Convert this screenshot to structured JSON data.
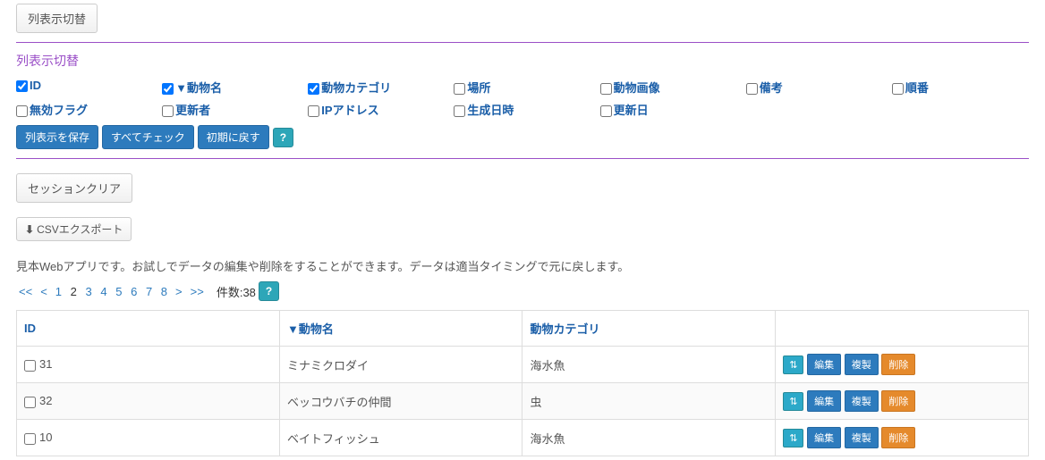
{
  "toggleButton": "列表示切替",
  "toggleTitle": "列表示切替",
  "columns": [
    {
      "label": "ID",
      "checked": true
    },
    {
      "label": "▼動物名",
      "checked": true
    },
    {
      "label": "動物カテゴリ",
      "checked": true
    },
    {
      "label": "場所",
      "checked": false
    },
    {
      "label": "動物画像",
      "checked": false
    },
    {
      "label": "備考",
      "checked": false
    },
    {
      "label": "順番",
      "checked": false
    },
    {
      "label": "無効フラグ",
      "checked": false
    },
    {
      "label": "更新者",
      "checked": false
    },
    {
      "label": "IPアドレス",
      "checked": false
    },
    {
      "label": "生成日時",
      "checked": false
    },
    {
      "label": "更新日",
      "checked": false
    }
  ],
  "saveCols": "列表示を保存",
  "checkAll": "すべてチェック",
  "resetCols": "初期に戻す",
  "help": "?",
  "sessionClear": "セッションクリア",
  "csvExport": "CSVエクスポート",
  "infoText": "見本Webアプリです。お試しでデータの編集や削除をすることができます。データは適当タイミングで元に戻します。",
  "pager": {
    "first": "<<",
    "prev": "<",
    "pages": [
      "1",
      "2",
      "3",
      "4",
      "5",
      "6",
      "7",
      "8"
    ],
    "current": "2",
    "next": ">",
    "last": ">>",
    "countLabel": "件数:",
    "countValue": "38"
  },
  "headers": {
    "id": "ID",
    "name": "▼動物名",
    "category": "動物カテゴリ",
    "actions": ""
  },
  "rows": [
    {
      "id": "31",
      "name": "ミナミクロダイ",
      "category": "海水魚"
    },
    {
      "id": "32",
      "name": "ベッコウバチの仲間",
      "category": "虫"
    },
    {
      "id": "10",
      "name": "ベイトフィッシュ",
      "category": "海水魚"
    }
  ],
  "actions": {
    "sort": "⇅",
    "edit": "編集",
    "copy": "複製",
    "delete": "削除"
  }
}
